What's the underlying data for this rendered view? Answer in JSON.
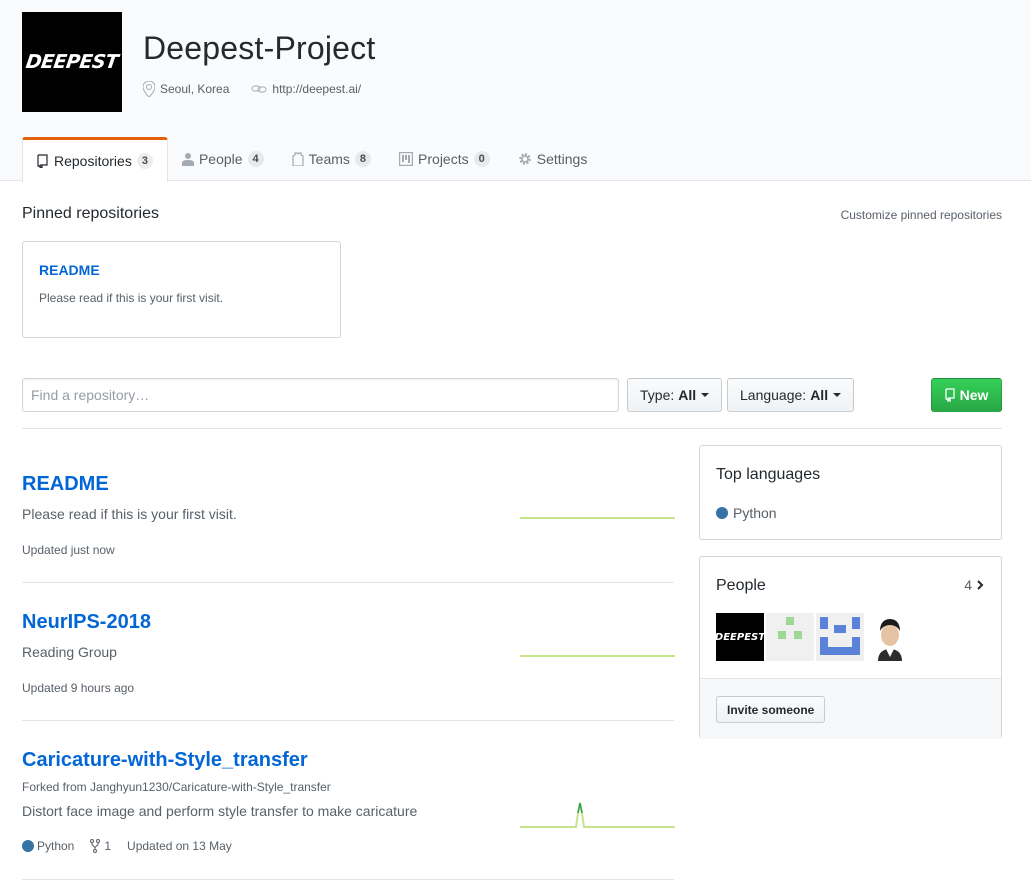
{
  "org": {
    "logo_text": "DEEPEST",
    "name": "Deepest-Project",
    "location": "Seoul, Korea",
    "website": "http://deepest.ai/"
  },
  "tabs": [
    {
      "label": "Repositories",
      "count": "3",
      "icon": "repo-icon",
      "selected": true
    },
    {
      "label": "People",
      "count": "4",
      "icon": "person-icon"
    },
    {
      "label": "Teams",
      "count": "8",
      "icon": "jersey-icon"
    },
    {
      "label": "Projects",
      "count": "0",
      "icon": "project-icon"
    },
    {
      "label": "Settings",
      "icon": "gear-icon"
    }
  ],
  "pinned": {
    "title": "Pinned repositories",
    "customize_label": "Customize pinned repositories",
    "items": [
      {
        "name": "README",
        "description": "Please read if this is your first visit."
      }
    ]
  },
  "filters": {
    "search_placeholder": "Find a repository…",
    "type_label": "Type:",
    "type_value": "All",
    "language_label": "Language:",
    "language_value": "All",
    "new_label": "New"
  },
  "repos": [
    {
      "name": "README",
      "description": "Please read if this is your first visit.",
      "updated": "Updated just now"
    },
    {
      "name": "NeurIPS-2018",
      "description": "Reading Group",
      "updated": "Updated 9 hours ago"
    },
    {
      "name": "Caricature-with-Style_transfer",
      "forked_from": "Forked from Janghyun1230/Caricature-with-Style_transfer",
      "description": "Distort face image and perform style transfer to make caricature",
      "language": "Python",
      "forks": "1",
      "updated": "Updated on 13 May"
    }
  ],
  "top_languages": {
    "title": "Top languages",
    "items": [
      {
        "name": "Python",
        "color": "#3572A5"
      }
    ]
  },
  "people": {
    "title": "People",
    "count": "4",
    "invite_label": "Invite someone"
  },
  "colors": {
    "accent_tab": "#e36209",
    "link": "#0366d6",
    "new_button": "#28a745",
    "python": "#3572A5",
    "sparkline": "#c6e48b"
  }
}
